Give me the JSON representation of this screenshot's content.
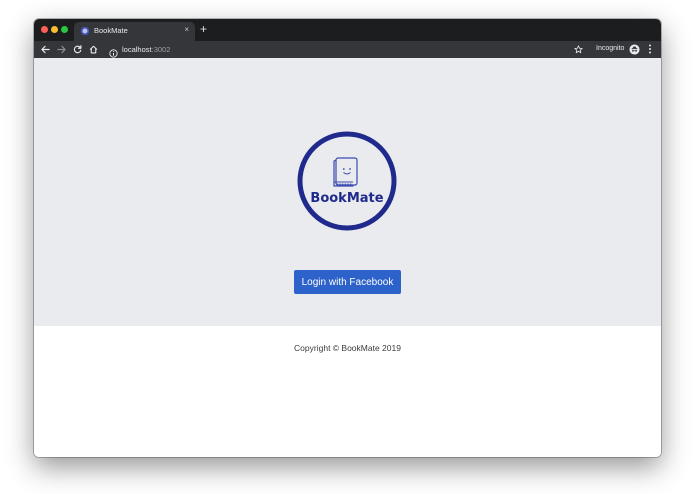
{
  "browser": {
    "tab": {
      "title": "BookMate",
      "close_glyph": "×"
    },
    "new_tab_glyph": "+",
    "address": {
      "host": "localhost",
      "port": ":3002"
    },
    "incognito_label": "Incognito",
    "icons": [
      "back-arrow-icon",
      "forward-arrow-icon",
      "reload-icon",
      "home-icon",
      "info-icon",
      "star-icon",
      "incognito-icon",
      "more-vert-icon"
    ]
  },
  "logo": {
    "text": "BookMate",
    "color": "#1f2a8c"
  },
  "login": {
    "label": "Login with Facebook",
    "color": "#2c62c9"
  },
  "footer": {
    "copyright": "Copyright © BookMate 2019"
  },
  "colors": {
    "hero_bg": "#eaebef",
    "footer_bg": "#ffffff",
    "chrome_dark": "#1c1d1f",
    "chrome_toolbar": "#35363a"
  }
}
